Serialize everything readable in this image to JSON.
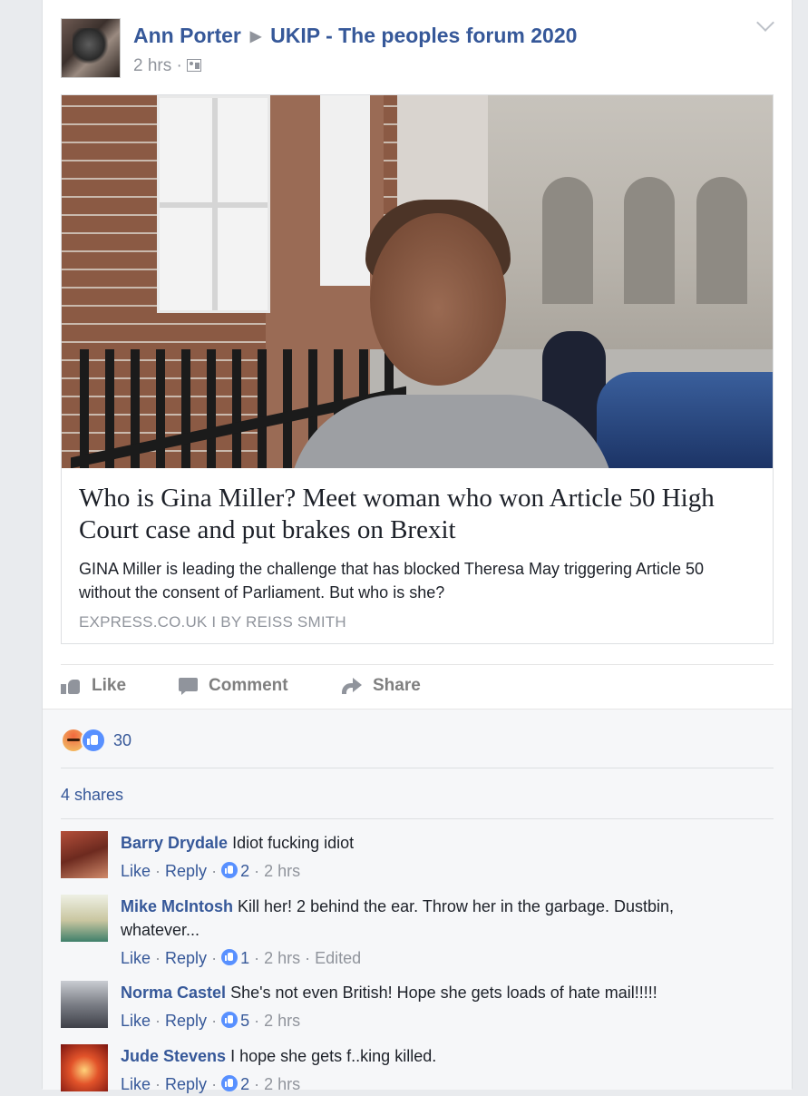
{
  "post": {
    "author": "Ann Porter",
    "group": "UKIP - The peoples forum 2020",
    "time": "2 hrs",
    "separator": "·",
    "icons": {
      "arrow": "triangle-right-icon",
      "audience": "group-members-icon",
      "menu": "chevron-down-icon"
    }
  },
  "link": {
    "headline": "Who is Gina Miller? Meet woman who won Article 50 High Court case and put brakes on Brexit",
    "summary": "GINA Miller is leading the challenge that has blocked Theresa May triggering Article 50 without the consent of Parliament. But who is she?",
    "source": "EXPRESS.CO.UK",
    "source_sep": "I",
    "byline": "BY REISS SMITH"
  },
  "actions": {
    "like": "Like",
    "comment": "Comment",
    "share": "Share"
  },
  "stats": {
    "reactions_count": "30",
    "reaction_types": [
      "angry",
      "like"
    ],
    "shares": "4 shares"
  },
  "comments": [
    {
      "name": "Barry Drydale",
      "text": "Idiot fucking idiot",
      "like": "Like",
      "reply": "Reply",
      "likes": "2",
      "time": "2 hrs",
      "edited": ""
    },
    {
      "name": "Mike McIntosh",
      "text": "Kill her! 2 behind the ear. Throw her in the garbage. Dustbin, whatever...",
      "like": "Like",
      "reply": "Reply",
      "likes": "1",
      "time": "2 hrs",
      "edited": "Edited"
    },
    {
      "name": "Norma Castel",
      "text": "She's not even British! Hope she gets loads of hate mail!!!!!",
      "like": "Like",
      "reply": "Reply",
      "likes": "5",
      "time": "2 hrs",
      "edited": ""
    },
    {
      "name": "Jude Stevens",
      "text": "I hope she gets f..king killed.",
      "like": "Like",
      "reply": "Reply",
      "likes": "2",
      "time": "2 hrs",
      "edited": ""
    }
  ],
  "colors": {
    "link_blue": "#365899",
    "meta_gray": "#90949c",
    "like_blue": "#5890ff",
    "background": "#e9ebee"
  }
}
